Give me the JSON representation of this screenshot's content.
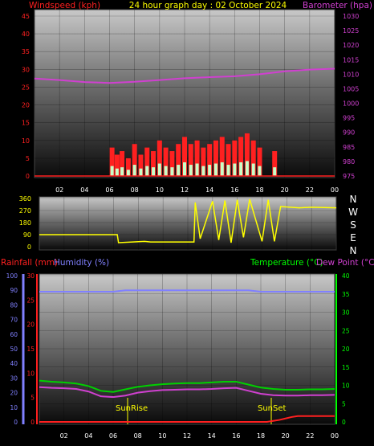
{
  "header": {
    "left_label": "Windspeed (kph)",
    "title": "24 hour graph day : 02 October 2024",
    "right_label": "Barometer (hpa)"
  },
  "direction_labels": [
    "N",
    "W",
    "S",
    "E",
    "N"
  ],
  "lower_labels": {
    "rainfall": "Rainfall (mm)",
    "humidity": "Humidity (%)",
    "temperature": "Temperature (°C)",
    "dewpoint": "Dew Point (°C)"
  },
  "annotations": {
    "sunrise": "SunRise",
    "sunset": "SunSet"
  },
  "colors": {
    "wind": "#ff2020",
    "gust": "#ff0000",
    "avgwind": "#2ea02e",
    "windlow": "#c8ffc8",
    "baro": "#d040d0",
    "dir": "#ffff00",
    "rain": "#ff2020",
    "humidity": "#8080ff",
    "temperature": "#00d000",
    "dewpoint": "#d040d0",
    "title": "#ffff00",
    "tempaxis": "#00ff00",
    "dateaxis": "#ffff00"
  },
  "chart_data": [
    {
      "type": "line",
      "title": "24 hour graph day : 02 October 2024",
      "xlabel": "",
      "x_ticks": [
        "02",
        "04",
        "06",
        "08",
        "10",
        "12",
        "14",
        "16",
        "18",
        "20",
        "22",
        "00"
      ],
      "xlim": [
        0,
        24
      ],
      "y_left": {
        "label": "Windspeed (kph)",
        "ticks": [
          0,
          5,
          10,
          15,
          20,
          25,
          30,
          35,
          40,
          45
        ],
        "lim": [
          0,
          45
        ]
      },
      "y_right": {
        "label": "Barometer (hpa)",
        "ticks": [
          975,
          980,
          985,
          990,
          995,
          1000,
          1005,
          1010,
          1015,
          1020,
          1025,
          1030
        ],
        "lim": [
          975,
          1030
        ]
      },
      "grid": true,
      "series": [
        {
          "name": "Windspeed (kph)",
          "axis": "left",
          "x": [
            6.2,
            6.6,
            7.0,
            7.5,
            8.0,
            8.5,
            9.0,
            9.5,
            10.0,
            10.5,
            11.0,
            11.5,
            12.0,
            12.5,
            13.0,
            13.5,
            14.0,
            14.5,
            15.0,
            15.5,
            16.0,
            16.5,
            17.0,
            17.5,
            18.0,
            19.2
          ],
          "y": [
            8,
            6,
            7,
            5,
            9,
            6,
            8,
            7,
            10,
            8,
            7,
            9,
            11,
            9,
            10,
            8,
            9,
            10,
            11,
            9,
            10,
            11,
            12,
            10,
            8,
            7
          ]
        },
        {
          "name": "Barometer (hpa)",
          "axis": "right",
          "x": [
            0,
            2,
            4,
            6,
            8,
            10,
            12,
            14,
            16,
            18,
            20,
            22,
            24
          ],
          "y": [
            1008.5,
            1008.0,
            1007.3,
            1007.0,
            1007.4,
            1008.0,
            1008.6,
            1009.0,
            1009.3,
            1010.0,
            1011.0,
            1011.6,
            1011.9
          ]
        }
      ]
    },
    {
      "type": "line",
      "x_ticks": [],
      "xlim": [
        0,
        24
      ],
      "y_left": {
        "label": "",
        "ticks": [
          0,
          90,
          180,
          270,
          360
        ],
        "lim": [
          0,
          360
        ]
      },
      "grid": true,
      "series": [
        {
          "name": "Wind direction",
          "axis": "left",
          "x": [
            0,
            6.3,
            6.4,
            8.5,
            9.0,
            12.5,
            12.6,
            13.0,
            14.0,
            14.5,
            15.0,
            15.5,
            16.0,
            16.5,
            17.0,
            18.0,
            18.5,
            19.0,
            19.5,
            21.0,
            22.0,
            24.0
          ],
          "y": [
            90,
            90,
            30,
            40,
            35,
            35,
            330,
            60,
            340,
            50,
            345,
            30,
            350,
            70,
            355,
            40,
            350,
            40,
            300,
            290,
            295,
            290
          ]
        }
      ]
    },
    {
      "type": "line",
      "x_ticks": [
        "02",
        "04",
        "06",
        "08",
        "10",
        "12",
        "14",
        "16",
        "18",
        "20",
        "22",
        "00"
      ],
      "xlim": [
        0,
        24
      ],
      "y_axes": {
        "humidity": {
          "label": "Humidity (%)",
          "ticks": [
            0,
            10,
            20,
            30,
            40,
            50,
            60,
            70,
            80,
            90,
            100
          ],
          "lim": [
            0,
            100
          ]
        },
        "rainfall": {
          "label": "Rainfall (mm)",
          "ticks": [
            0,
            5,
            10,
            15,
            20,
            25,
            30
          ],
          "lim": [
            0,
            30
          ]
        },
        "temperature": {
          "label": "Temperature (°C)",
          "ticks": [
            0,
            5,
            10,
            15,
            20,
            25,
            30,
            35,
            40
          ],
          "lim": [
            0,
            40
          ]
        }
      },
      "grid": true,
      "series": [
        {
          "name": "Humidity (%)",
          "axis": "humidity",
          "x": [
            0,
            2,
            4,
            6,
            7,
            8,
            10,
            12,
            14,
            16,
            17,
            18,
            19,
            20,
            22,
            24
          ],
          "y": [
            89,
            89,
            89,
            89,
            90,
            90,
            90,
            90,
            90,
            90,
            90,
            89,
            89,
            89,
            89,
            89
          ]
        },
        {
          "name": "Rainfall (mm)",
          "axis": "rainfall",
          "x": [
            0,
            18.5,
            19.0,
            19.5,
            20.0,
            20.5,
            21.0,
            24.0
          ],
          "y": [
            0,
            0,
            0.2,
            0.4,
            0.7,
            1.0,
            1.2,
            1.2
          ]
        },
        {
          "name": "Temperature (°C)",
          "axis": "temperature",
          "x": [
            0,
            1,
            2,
            3,
            4,
            5,
            6,
            7,
            8,
            9,
            10,
            11,
            12,
            13,
            14,
            15,
            16,
            17,
            18,
            19,
            20,
            21,
            22,
            23,
            24
          ],
          "y": [
            11.3,
            11.0,
            10.8,
            10.5,
            9.8,
            8.5,
            8.2,
            8.9,
            9.6,
            10.0,
            10.3,
            10.5,
            10.6,
            10.6,
            10.8,
            11.0,
            11.0,
            10.2,
            9.4,
            9.0,
            8.8,
            8.8,
            8.9,
            8.9,
            9.0
          ]
        },
        {
          "name": "Dew Point (°C)",
          "axis": "temperature",
          "x": [
            0,
            1,
            2,
            3,
            4,
            5,
            6,
            7,
            8,
            9,
            10,
            11,
            12,
            13,
            14,
            15,
            16,
            17,
            18,
            19,
            20,
            21,
            22,
            23,
            24
          ],
          "y": [
            9.5,
            9.3,
            9.2,
            9.0,
            8.3,
            7.0,
            6.8,
            7.2,
            8.0,
            8.4,
            8.7,
            8.8,
            8.9,
            8.9,
            9.0,
            9.2,
            9.3,
            8.5,
            7.7,
            7.3,
            7.2,
            7.2,
            7.3,
            7.3,
            7.4
          ]
        }
      ]
    }
  ]
}
